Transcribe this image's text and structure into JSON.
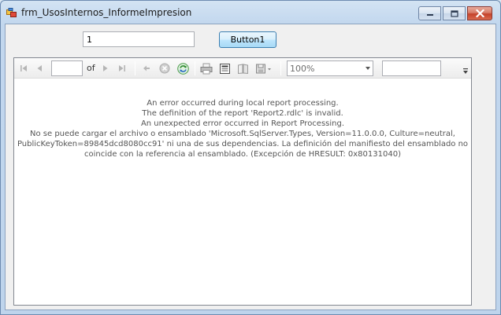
{
  "window": {
    "title": "frm_UsosInternos_InformeImpresion"
  },
  "form": {
    "textbox_value": "1",
    "button_label": "Button1"
  },
  "report_toolbar": {
    "page_current": "",
    "of_label": "of",
    "zoom_value": "100%",
    "find_value": ""
  },
  "report_body": {
    "error_lines": [
      "An error occurred during local report processing.",
      "The definition of the report 'Report2.rdlc' is invalid.",
      "An unexpected error occurred in Report Processing.",
      "No se puede cargar el archivo o ensamblado 'Microsoft.SqlServer.Types, Version=11.0.0.0, Culture=neutral,",
      "PublicKeyToken=89845dcd8080cc91' ni una de sus dependencias. La definición del manifiesto del ensamblado no",
      "coincide con la referencia al ensamblado. (Excepción de HRESULT: 0x80131040)"
    ]
  },
  "icons": {
    "first_page": "first-page-icon",
    "prev_page": "previous-page-icon",
    "next_page": "next-page-icon",
    "last_page": "last-page-icon",
    "back": "back-icon",
    "stop": "stop-icon",
    "refresh": "refresh-icon",
    "print": "print-icon",
    "print_layout": "print-layout-icon",
    "page_setup": "page-setup-icon",
    "export": "export-icon"
  }
}
